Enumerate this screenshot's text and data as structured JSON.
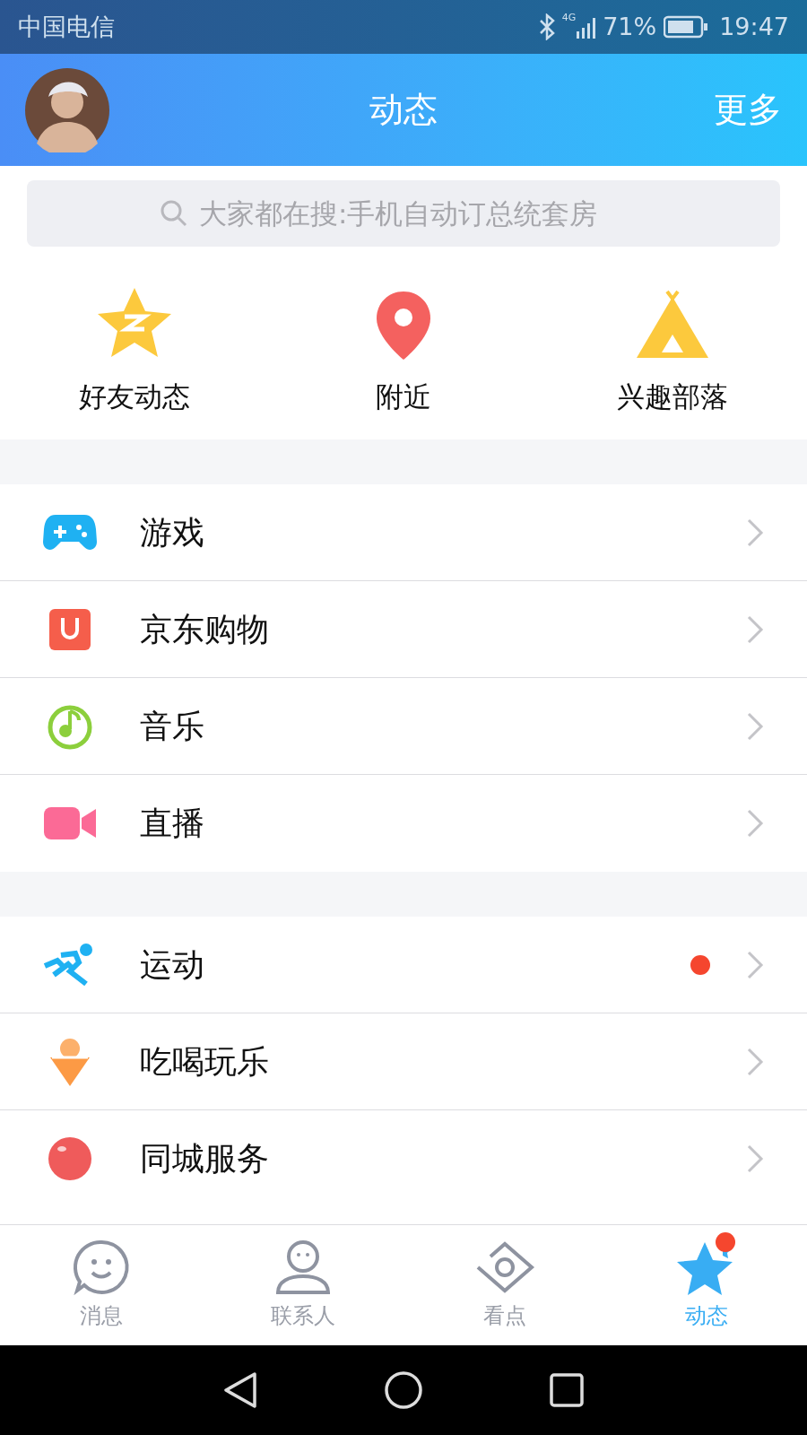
{
  "status_bar": {
    "carrier": "中国电信",
    "network": "4G",
    "battery": "71%",
    "time": "19:47"
  },
  "header": {
    "title": "动态",
    "action": "更多"
  },
  "search": {
    "placeholder": "大家都在搜:手机自动订总统套房"
  },
  "quick_links": [
    {
      "kind": "star",
      "label": "好友动态"
    },
    {
      "kind": "pin",
      "label": "附近"
    },
    {
      "kind": "tent",
      "label": "兴趣部落"
    }
  ],
  "sections": [
    [
      {
        "kind": "game",
        "label": "游戏",
        "badge": false
      },
      {
        "kind": "shop",
        "label": "京东购物",
        "badge": false
      },
      {
        "kind": "music",
        "label": "音乐",
        "badge": false
      },
      {
        "kind": "live",
        "label": "直播",
        "badge": false
      }
    ],
    [
      {
        "kind": "sport",
        "label": "运动",
        "badge": true
      },
      {
        "kind": "food",
        "label": "吃喝玩乐",
        "badge": false
      },
      {
        "kind": "city",
        "label": "同城服务",
        "badge": false
      }
    ]
  ],
  "tabs": [
    {
      "kind": "chat",
      "label": "消息",
      "selected": false,
      "badge": false
    },
    {
      "kind": "contact",
      "label": "联系人",
      "selected": false,
      "badge": false
    },
    {
      "kind": "eye",
      "label": "看点",
      "selected": false,
      "badge": false
    },
    {
      "kind": "star",
      "label": "动态",
      "selected": true,
      "badge": true
    }
  ]
}
